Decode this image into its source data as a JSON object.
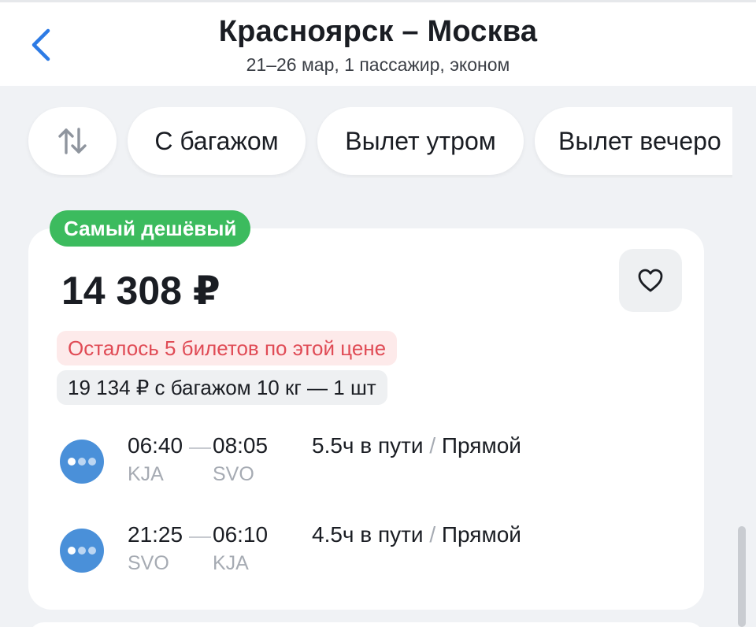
{
  "header": {
    "title_from": "Красноярск",
    "title_dash": "–",
    "title_to": "Москва",
    "subtitle": "21–26 мар, 1 пассажир, эконом",
    "back_icon": "chevron-left-icon"
  },
  "filters": {
    "sort_icon": "sort-arrows-icon",
    "chips": [
      "С багажом",
      "Вылет утром",
      "Вылет вечеро"
    ]
  },
  "offer": {
    "badge": "Самый дешёвый",
    "price": "14 308 ₽",
    "favorite_icon": "heart-icon",
    "tickets_left": "Осталось 5 билетов по этой цене",
    "baggage_price": "19 134 ₽ с багажом 10 кг — 1 шт",
    "segments": [
      {
        "dep_time": "06:40",
        "arr_time": "08:05",
        "dep_code": "KJA",
        "arr_code": "SVO",
        "duration": "5.5ч в пути",
        "slash": "/",
        "type": "Прямой"
      },
      {
        "dep_time": "21:25",
        "arr_time": "06:10",
        "dep_code": "SVO",
        "arr_code": "KJA",
        "duration": "4.5ч в пути",
        "slash": "/",
        "type": "Прямой"
      }
    ]
  },
  "colors": {
    "accent_blue": "#2d7be5",
    "badge_green": "#3cbb5e",
    "warning_red": "#e04b55",
    "airline_blue": "#4a90d9"
  }
}
